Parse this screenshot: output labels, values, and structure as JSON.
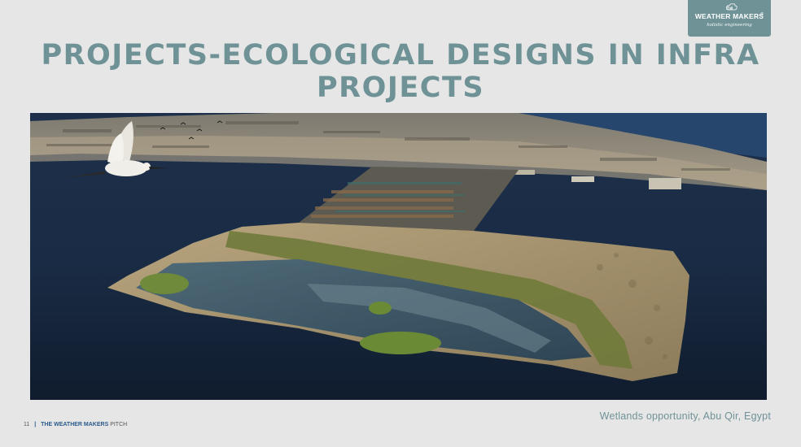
{
  "logo": {
    "the": "the",
    "brand": "WEATHER MAKERS",
    "tagline": "holistic engineering",
    "registered": "®"
  },
  "title": "PROJECTS-ECOLOGICAL DESIGNS IN INFRA PROJECTS",
  "image": {
    "subject": "Aerial view of a container port with a wetland island in the sea and a flying egret"
  },
  "caption": "Wetlands opportunity, Abu Qir, Egypt",
  "footer": {
    "page_number": "11",
    "separator": "|",
    "brand": "THE WEATHER MAKERS",
    "suffix": " PITCH"
  },
  "colors": {
    "accent": "#6f9297",
    "background": "#e6e6e6",
    "footer_brand": "#2a5b8c"
  }
}
